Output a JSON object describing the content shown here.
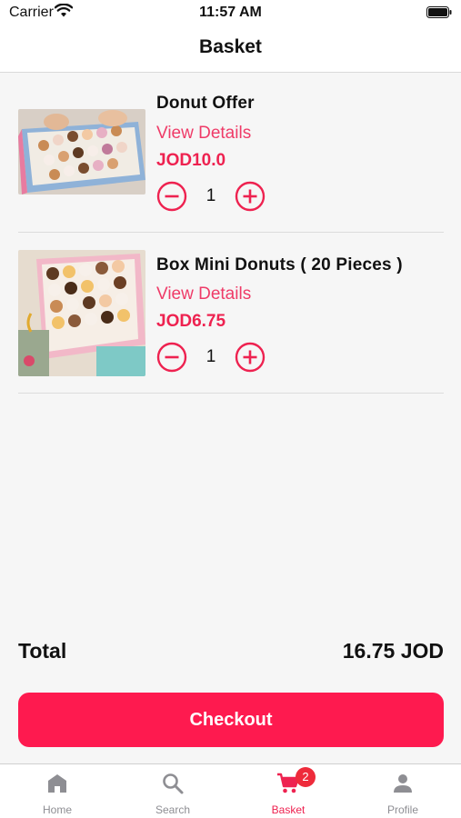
{
  "status_bar": {
    "carrier": "Carrier",
    "time": "11:57 AM"
  },
  "header": {
    "title": "Basket"
  },
  "basket": {
    "items": [
      {
        "name": "Donut Offer",
        "details_label": "View Details",
        "price": "JOD10.0",
        "quantity": "1",
        "image_icon": "donut-box-photo"
      },
      {
        "name": "Box Mini Donuts  ( 20 Pieces )",
        "details_label": "View Details",
        "price": "JOD6.75",
        "quantity": "1",
        "image_icon": "mini-donuts-box-photo"
      }
    ]
  },
  "summary": {
    "total_label": "Total",
    "total_value": "16.75 JOD"
  },
  "checkout": {
    "label": "Checkout"
  },
  "tab_bar": {
    "tabs": [
      {
        "label": "Home",
        "icon": "home-icon"
      },
      {
        "label": "Search",
        "icon": "search-icon"
      },
      {
        "label": "Basket",
        "icon": "cart-icon",
        "badge": "2",
        "active": true
      },
      {
        "label": "Profile",
        "icon": "person-icon"
      }
    ]
  },
  "colors": {
    "accent": "#fe1a4f",
    "price": "#ee2250",
    "link": "#ef3b68",
    "badge": "#ee2b3b",
    "inactive_tab": "#8e8e93"
  }
}
